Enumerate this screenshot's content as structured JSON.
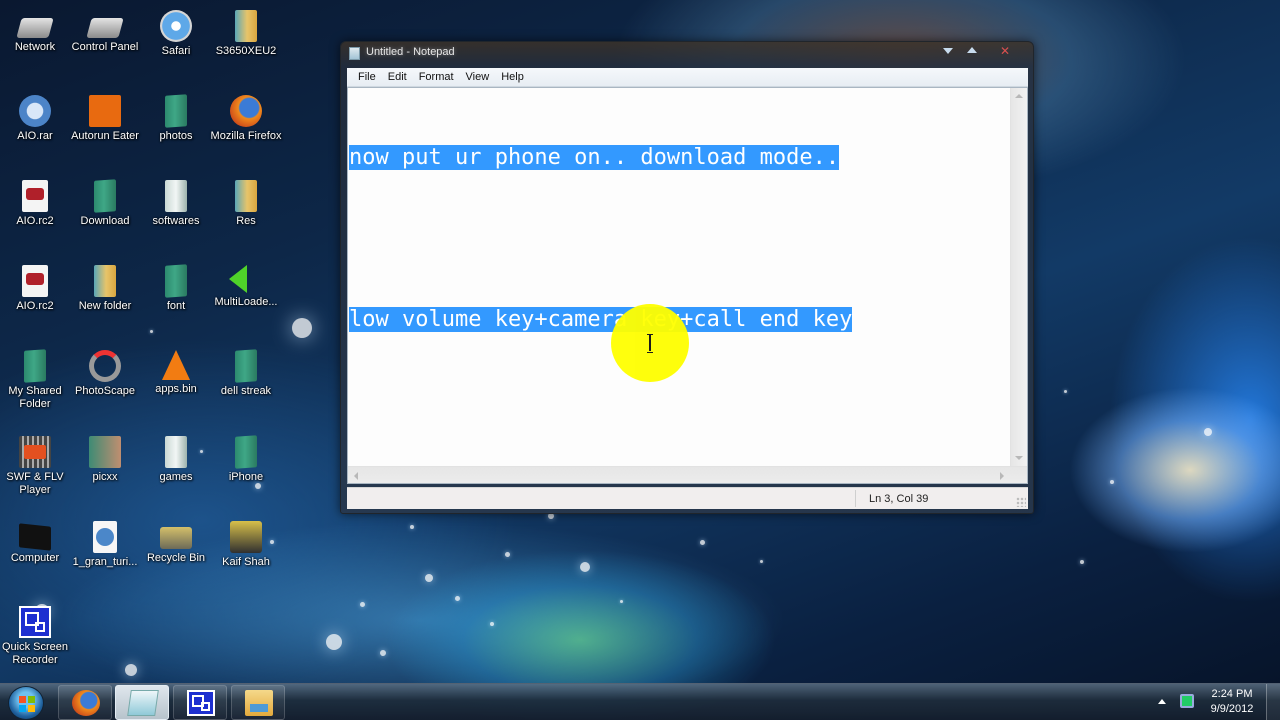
{
  "desktop": {
    "icons": [
      {
        "label": "Network",
        "icon": "network-icon"
      },
      {
        "label": "Control Panel",
        "icon": "control-panel-icon"
      },
      {
        "label": "Safari",
        "icon": "safari-icon"
      },
      {
        "label": "S3650XEU2",
        "icon": "folder-icon"
      },
      {
        "label": "AIO.rar",
        "icon": "rar-archive-icon"
      },
      {
        "label": "Autorun Eater",
        "icon": "autorun-eater-icon"
      },
      {
        "label": "photos",
        "icon": "folder-icon"
      },
      {
        "label": "Mozilla Firefox",
        "icon": "firefox-icon"
      },
      {
        "label": "AIO.rc2",
        "icon": "rc2-file-icon"
      },
      {
        "label": "Download",
        "icon": "folder-icon"
      },
      {
        "label": "softwares",
        "icon": "folder-icon"
      },
      {
        "label": "Res",
        "icon": "folder-icon"
      },
      {
        "label": "AIO.rc2",
        "icon": "rc2-shortcut-icon"
      },
      {
        "label": "New folder",
        "icon": "folder-icon"
      },
      {
        "label": "font",
        "icon": "folder-icon"
      },
      {
        "label": "MultiLoade...",
        "icon": "green-arrow-icon"
      },
      {
        "label": "My Shared Folder",
        "icon": "folder-icon"
      },
      {
        "label": "PhotoScape",
        "icon": "photoscape-icon"
      },
      {
        "label": "apps.bin",
        "icon": "vlc-icon"
      },
      {
        "label": "dell streak",
        "icon": "folder-icon"
      },
      {
        "label": "SWF & FLV Player",
        "icon": "swf-player-icon"
      },
      {
        "label": "picxx",
        "icon": "folder-icon"
      },
      {
        "label": "games",
        "icon": "folder-icon"
      },
      {
        "label": "iPhone",
        "icon": "folder-icon"
      },
      {
        "label": "Computer",
        "icon": "computer-icon"
      },
      {
        "label": "1_gran_turi...",
        "icon": "document-icon"
      },
      {
        "label": "Recycle Bin",
        "icon": "recycle-bin-icon"
      },
      {
        "label": "Kaif Shah",
        "icon": "user-folder-icon"
      },
      {
        "label": "Quick Screen Recorder",
        "icon": "quick-screen-recorder-icon"
      }
    ]
  },
  "notepad": {
    "title": "Untitled - Notepad",
    "menu": [
      "File",
      "Edit",
      "Format",
      "View",
      "Help"
    ],
    "lines": [
      "now put ur phone on.. download mode..",
      "",
      "low volume key+camera key+call end key"
    ],
    "selection_color": "#3399ff",
    "status": "Ln 3, Col 39"
  },
  "taskbar": {
    "items": [
      {
        "name": "firefox",
        "active": false
      },
      {
        "name": "notepad",
        "active": true
      },
      {
        "name": "quick-screen-recorder",
        "active": false
      },
      {
        "name": "windows-explorer",
        "active": false
      }
    ],
    "clock": {
      "time": "2:24 PM",
      "date": "9/9/2012"
    }
  }
}
